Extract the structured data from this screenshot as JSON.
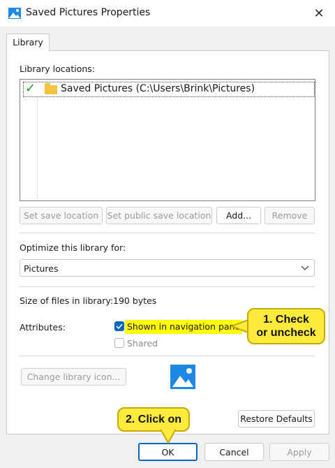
{
  "window": {
    "title": "Saved Pictures Properties",
    "close_glyph": "✕"
  },
  "tabs": [
    {
      "label": "Library"
    }
  ],
  "library_locations": {
    "label": "Library locations:",
    "items": [
      {
        "check": "✓",
        "text": "Saved Pictures (C:\\Users\\Brink\\Pictures)"
      }
    ]
  },
  "location_buttons": {
    "set_save": "Set save location",
    "set_public_save": "Set public save location",
    "add": "Add...",
    "remove": "Remove"
  },
  "optimize": {
    "label": "Optimize this library for:",
    "selected": "Pictures"
  },
  "size": {
    "label": "Size of files in library:",
    "value": "190 bytes"
  },
  "attributes": {
    "label": "Attributes:",
    "shown_in_nav": {
      "label": "Shown in navigation pane",
      "checked": true
    },
    "shared": {
      "label": "Shared",
      "checked": false
    }
  },
  "change_icon_button": "Change library icon...",
  "restore_defaults_button": "Restore Defaults",
  "footer": {
    "ok": "OK",
    "cancel": "Cancel",
    "apply": "Apply"
  },
  "callouts": {
    "check_line1": "1. Check",
    "check_line2": "or uncheck",
    "click": "2. Click on"
  },
  "colors": {
    "accent": "#0067c0",
    "callout": "#ffeb3b",
    "highlight": "#ffff00",
    "checkmark": "#1e9b1e"
  },
  "icons": [
    "picture-library-icon",
    "close-icon",
    "checkmark-icon",
    "folder-icon",
    "chevron-down-icon"
  ]
}
